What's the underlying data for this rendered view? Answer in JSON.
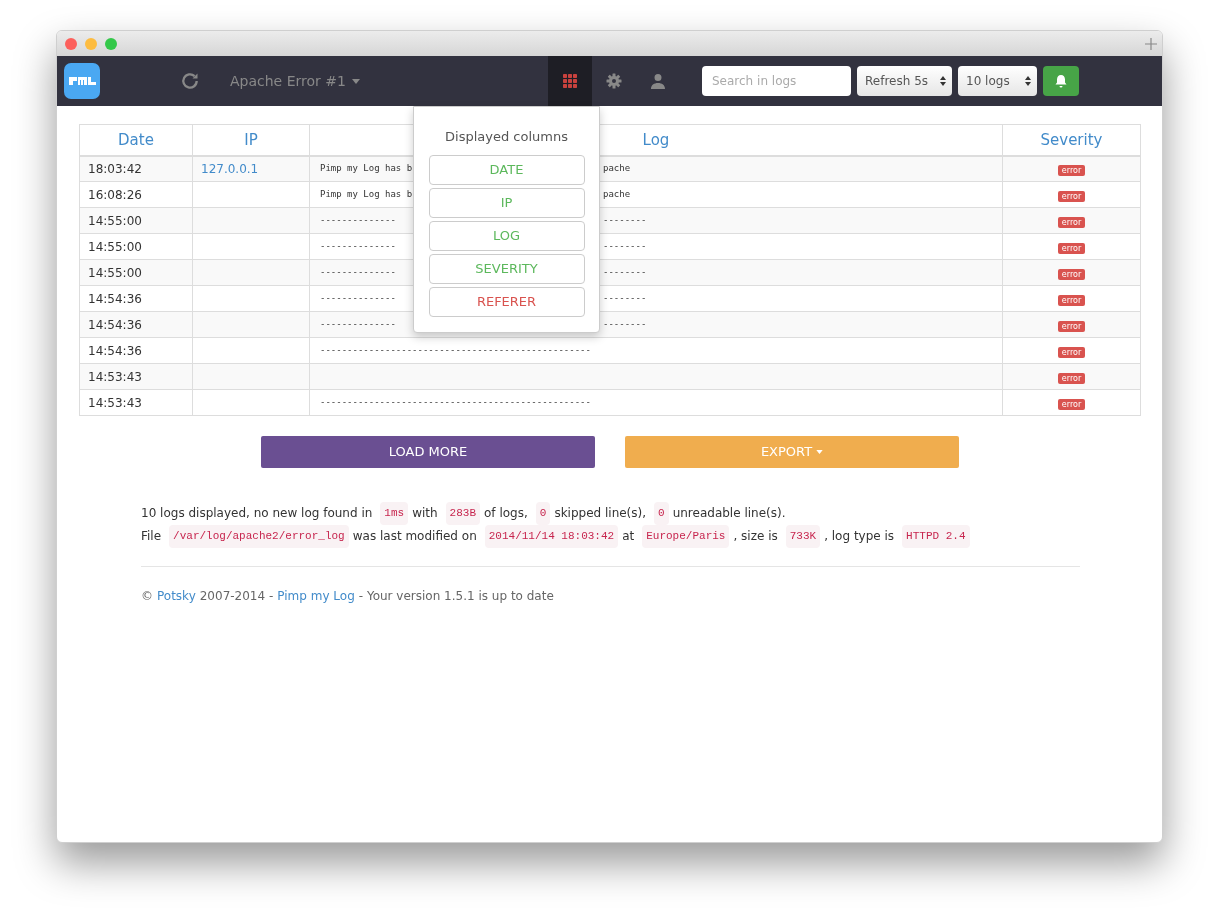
{
  "navbar": {
    "log_selector": "Apache Error #1",
    "search": {
      "placeholder": "Search in logs"
    },
    "refresh_select": "Refresh 5s",
    "count_select": "10 logs",
    "columns_button_active": true
  },
  "table": {
    "columns": [
      "Date",
      "IP",
      "Log",
      "Severity"
    ],
    "rows": [
      {
        "date": "18:03:42",
        "ip": "127.0.0.1",
        "log_start": "Pimp my Log has b",
        "log_end": "pache",
        "severity": "error"
      },
      {
        "date": "16:08:26",
        "log_start": "Pimp my Log has b",
        "log_end": "pache",
        "severity": "error"
      },
      {
        "date": "14:55:00",
        "log_start": "--------------",
        "log_end": "--------",
        "severity": "error"
      },
      {
        "date": "14:55:00",
        "log_start": "--------------",
        "log_end": "--------",
        "severity": "error"
      },
      {
        "date": "14:55:00",
        "log_start": "--------------",
        "log_end": "--------",
        "severity": "error"
      },
      {
        "date": "14:54:36",
        "log_start": "--------------",
        "log_end": "--------",
        "severity": "error"
      },
      {
        "date": "14:54:36",
        "log_start": "--------------",
        "log_end": "--------",
        "severity": "error"
      },
      {
        "date": "14:54:36",
        "log_start": "--------------------------------------------------",
        "severity": "error"
      },
      {
        "date": "14:53:43",
        "severity": "error"
      },
      {
        "date": "14:53:43",
        "log_start": "--------------------------------------------------",
        "severity": "error"
      }
    ]
  },
  "columns_menu": {
    "title": "Displayed columns",
    "items": [
      {
        "label": "DATE",
        "selected": true
      },
      {
        "label": "IP",
        "selected": true
      },
      {
        "label": "LOG",
        "selected": true
      },
      {
        "label": "SEVERITY",
        "selected": true
      },
      {
        "label": "REFERER",
        "selected": false
      }
    ]
  },
  "buttons": {
    "load_more": "LOAD MORE",
    "export": "EXPORT"
  },
  "status_lines": [
    [
      {
        "kind": "text",
        "text": "10 logs displayed, no new log found in"
      },
      {
        "kind": "code",
        "text": "1ms"
      },
      {
        "kind": "text",
        "text": "with"
      },
      {
        "kind": "code",
        "text": "283B"
      },
      {
        "kind": "text",
        "text": "of logs,"
      },
      {
        "kind": "code",
        "text": "0"
      },
      {
        "kind": "text",
        "text": "skipped line(s),"
      },
      {
        "kind": "code",
        "text": "0"
      },
      {
        "kind": "text",
        "text": "unreadable line(s)."
      }
    ],
    [
      {
        "kind": "text",
        "text": "File"
      },
      {
        "kind": "code",
        "text": "/var/log/apache2/error_log"
      },
      {
        "kind": "text",
        "text": "was last modified on"
      },
      {
        "kind": "code",
        "text": "2014/11/14 18:03:42"
      },
      {
        "kind": "text",
        "text": "at"
      },
      {
        "kind": "code",
        "text": "Europe/Paris"
      },
      {
        "kind": "text",
        "text": ", size is"
      },
      {
        "kind": "code",
        "text": "733K"
      },
      {
        "kind": "text",
        "text": ", log type is"
      },
      {
        "kind": "code",
        "text": "HTTPD 2.4"
      }
    ]
  ],
  "footer": [
    {
      "kind": "text",
      "text": "©"
    },
    {
      "kind": "link",
      "text": "Potsky"
    },
    {
      "kind": "text",
      "text": "2007-2014 -"
    },
    {
      "kind": "link",
      "text": "Pimp my Log"
    },
    {
      "kind": "text",
      "text": "- Your version 1.5.1 is up to date"
    }
  ]
}
